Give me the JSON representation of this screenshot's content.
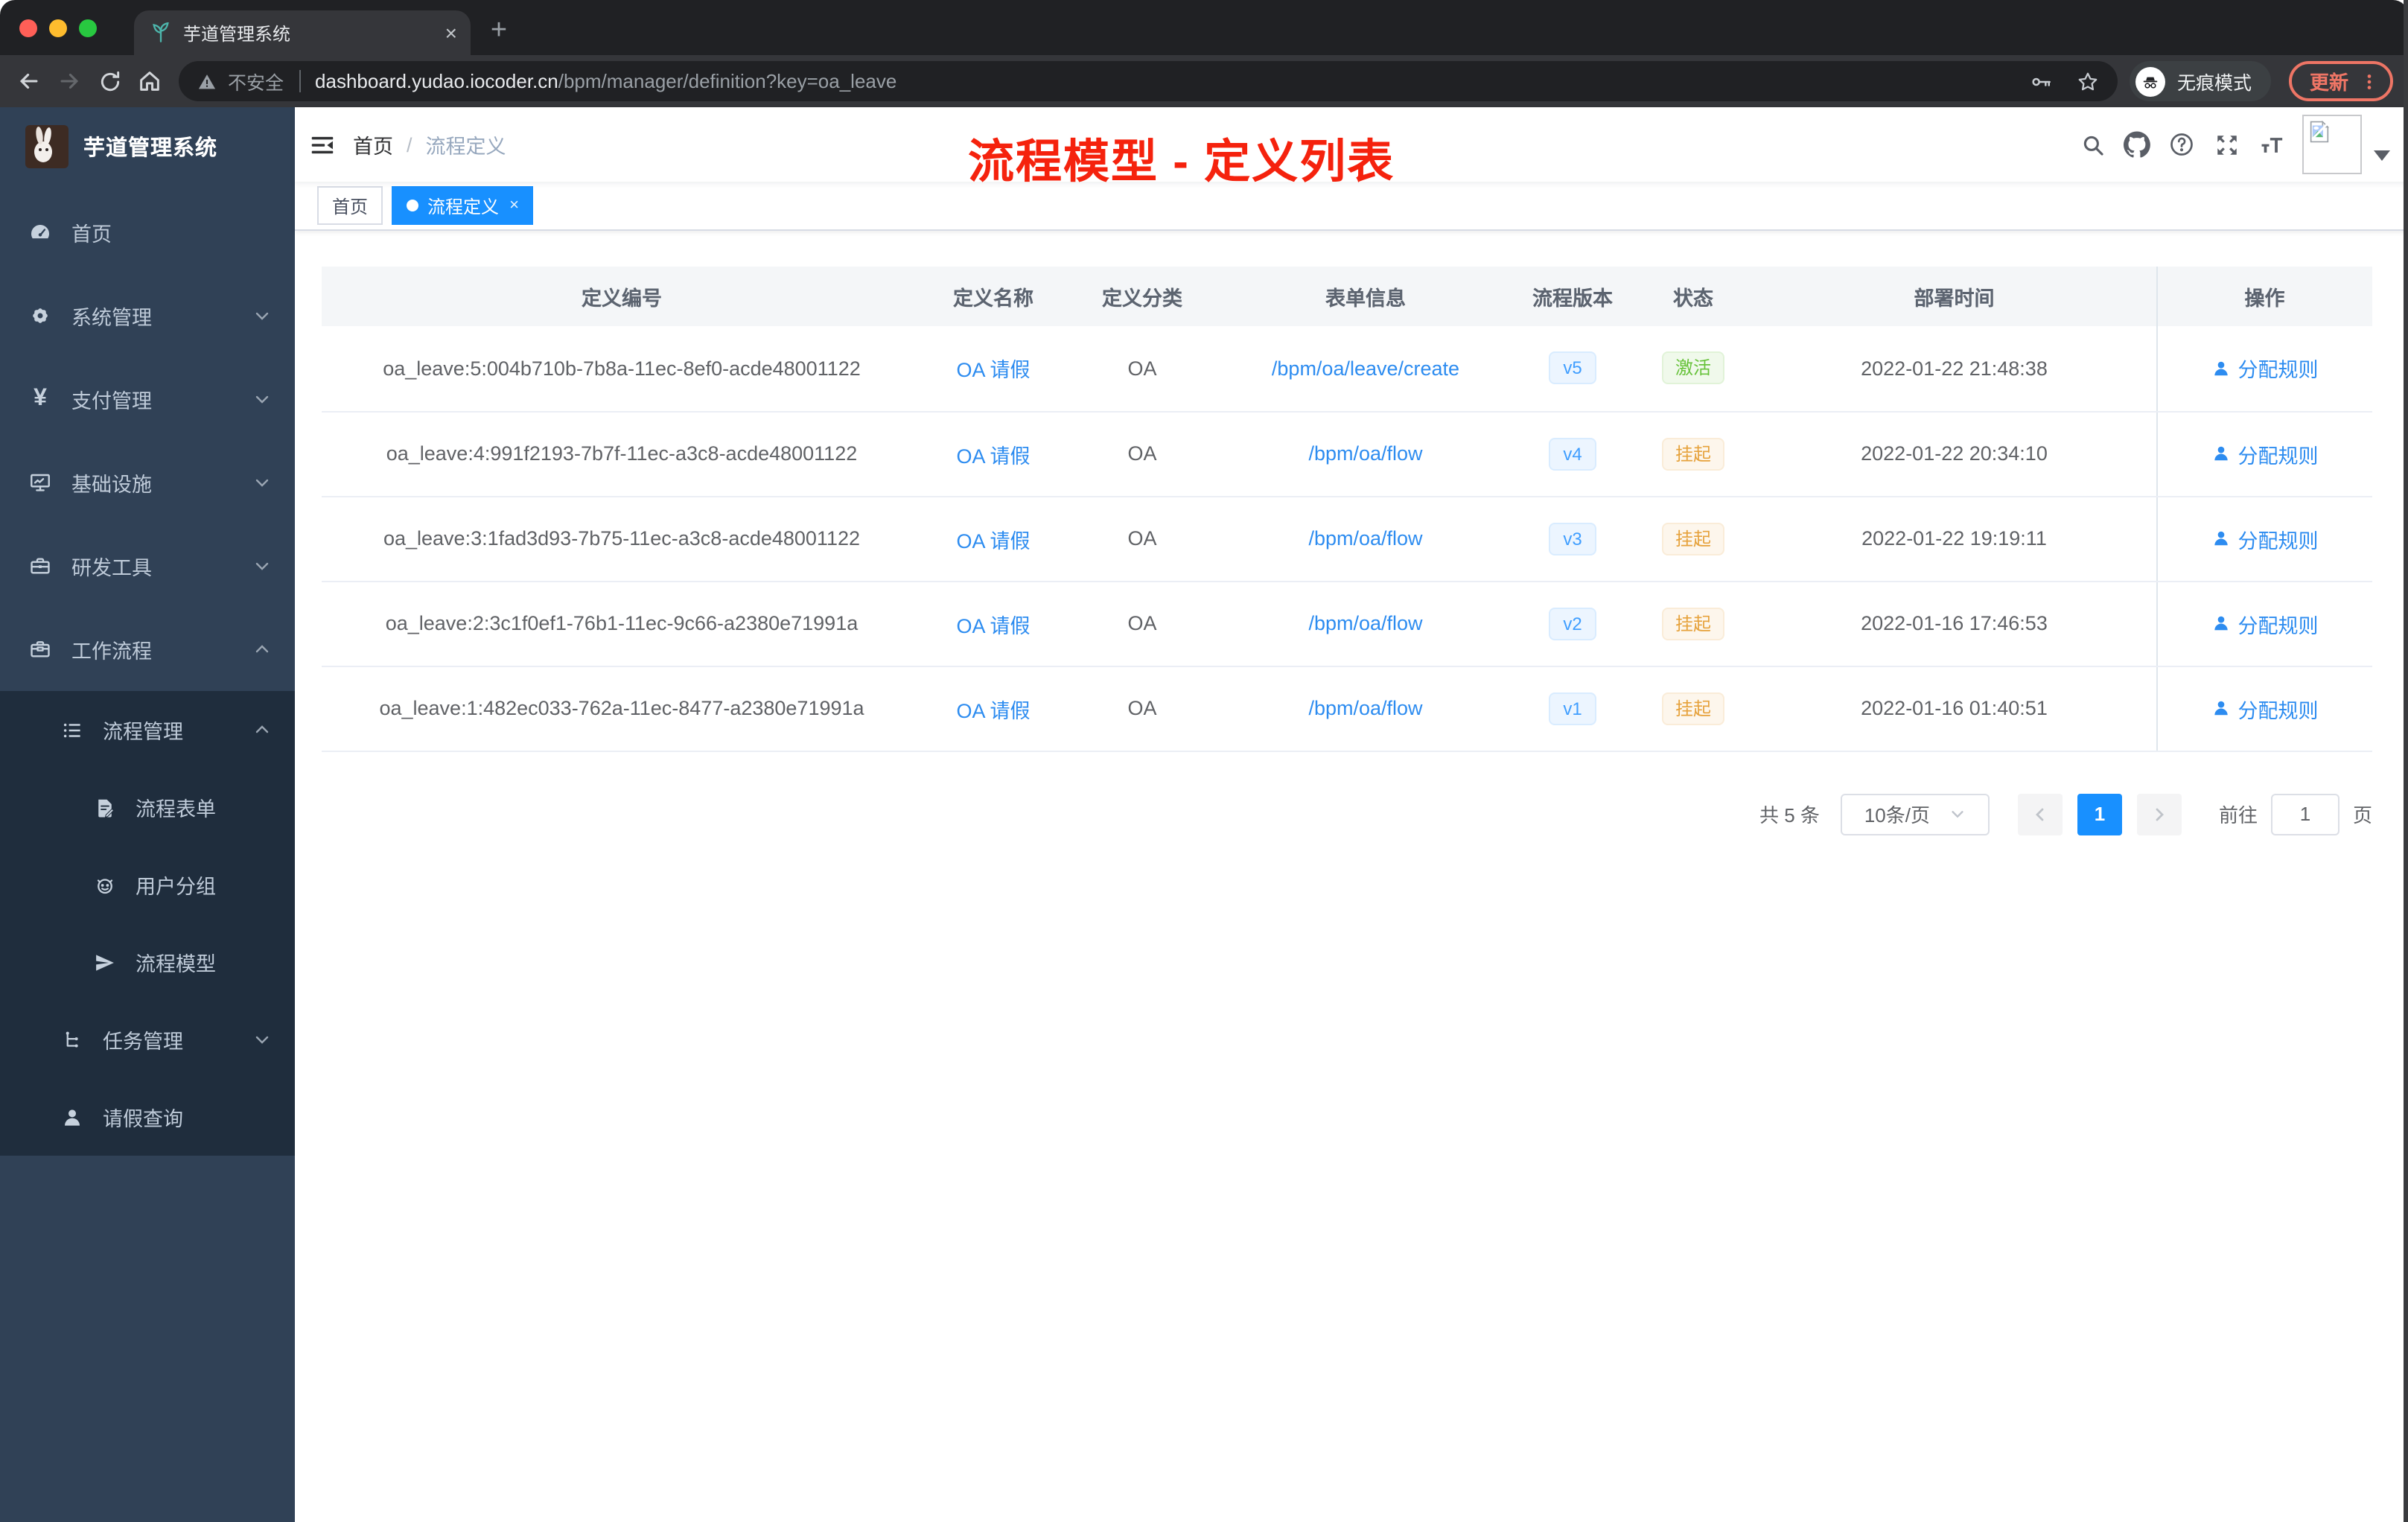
{
  "browser": {
    "tab_title": "芋道管理系统",
    "new_tab_glyph": "+",
    "close_tab_glyph": "×",
    "security_label": "不安全",
    "url_domain": "dashboard.yudao.iocoder.cn",
    "url_path": "/bpm/manager/definition?key=oa_leave",
    "incognito_label": "无痕模式",
    "update_label": "更新"
  },
  "sidebar": {
    "app_title": "芋道管理系统",
    "items": [
      {
        "label": "首页"
      },
      {
        "label": "系统管理"
      },
      {
        "label": "支付管理"
      },
      {
        "label": "基础设施"
      },
      {
        "label": "研发工具"
      },
      {
        "label": "工作流程"
      },
      {
        "label": "流程管理"
      },
      {
        "label": "流程表单"
      },
      {
        "label": "用户分组"
      },
      {
        "label": "流程模型"
      },
      {
        "label": "任务管理"
      },
      {
        "label": "请假查询"
      }
    ],
    "yen_glyph": "¥"
  },
  "navbar": {
    "breadcrumb_home": "首页",
    "breadcrumb_separator": "/",
    "breadcrumb_current": "流程定义"
  },
  "annotation": {
    "text": "流程模型 - 定义列表",
    "color": "#f5220d"
  },
  "tags_view": {
    "tags": [
      {
        "label": "首页"
      },
      {
        "label": "流程定义",
        "close_glyph": "×"
      }
    ]
  },
  "table": {
    "columns": [
      "定义编号",
      "定义名称",
      "定义分类",
      "表单信息",
      "流程版本",
      "状态",
      "部署时间",
      "操作"
    ],
    "rows": [
      {
        "id": "oa_leave:5:004b710b-7b8a-11ec-8ef0-acde48001122",
        "name": "OA 请假",
        "category": "OA",
        "form": "/bpm/oa/leave/create",
        "version": "v5",
        "status": "激活",
        "status_type": "active",
        "deploy_time": "2022-01-22 21:48:38",
        "action": "分配规则"
      },
      {
        "id": "oa_leave:4:991f2193-7b7f-11ec-a3c8-acde48001122",
        "name": "OA 请假",
        "category": "OA",
        "form": "/bpm/oa/flow",
        "version": "v4",
        "status": "挂起",
        "status_type": "suspended",
        "deploy_time": "2022-01-22 20:34:10",
        "action": "分配规则"
      },
      {
        "id": "oa_leave:3:1fad3d93-7b75-11ec-a3c8-acde48001122",
        "name": "OA 请假",
        "category": "OA",
        "form": "/bpm/oa/flow",
        "version": "v3",
        "status": "挂起",
        "status_type": "suspended",
        "deploy_time": "2022-01-22 19:19:11",
        "action": "分配规则"
      },
      {
        "id": "oa_leave:2:3c1f0ef1-76b1-11ec-9c66-a2380e71991a",
        "name": "OA 请假",
        "category": "OA",
        "form": "/bpm/oa/flow",
        "version": "v2",
        "status": "挂起",
        "status_type": "suspended",
        "deploy_time": "2022-01-16 17:46:53",
        "action": "分配规则"
      },
      {
        "id": "oa_leave:1:482ec033-762a-11ec-8477-a2380e71991a",
        "name": "OA 请假",
        "category": "OA",
        "form": "/bpm/oa/flow",
        "version": "v1",
        "status": "挂起",
        "status_type": "suspended",
        "deploy_time": "2022-01-16 01:40:51",
        "action": "分配规则"
      }
    ]
  },
  "pagination": {
    "total": "共 5 条",
    "page_size": "10条/页",
    "current_page": "1",
    "goto_label": "前往",
    "goto_value": "1",
    "page_unit": "页"
  },
  "colors": {
    "sidebar_bg": "#304156",
    "submenu_bg": "#1f2d3d",
    "primary_blue": "#1890ff",
    "link_blue": "#2d8cf0",
    "version_tag_text": "#409eff",
    "status_active_green": "#67c23a",
    "status_suspended_orange": "#e6a23c",
    "annotation_red": "#f5220d",
    "update_pill": "#ee7565"
  }
}
